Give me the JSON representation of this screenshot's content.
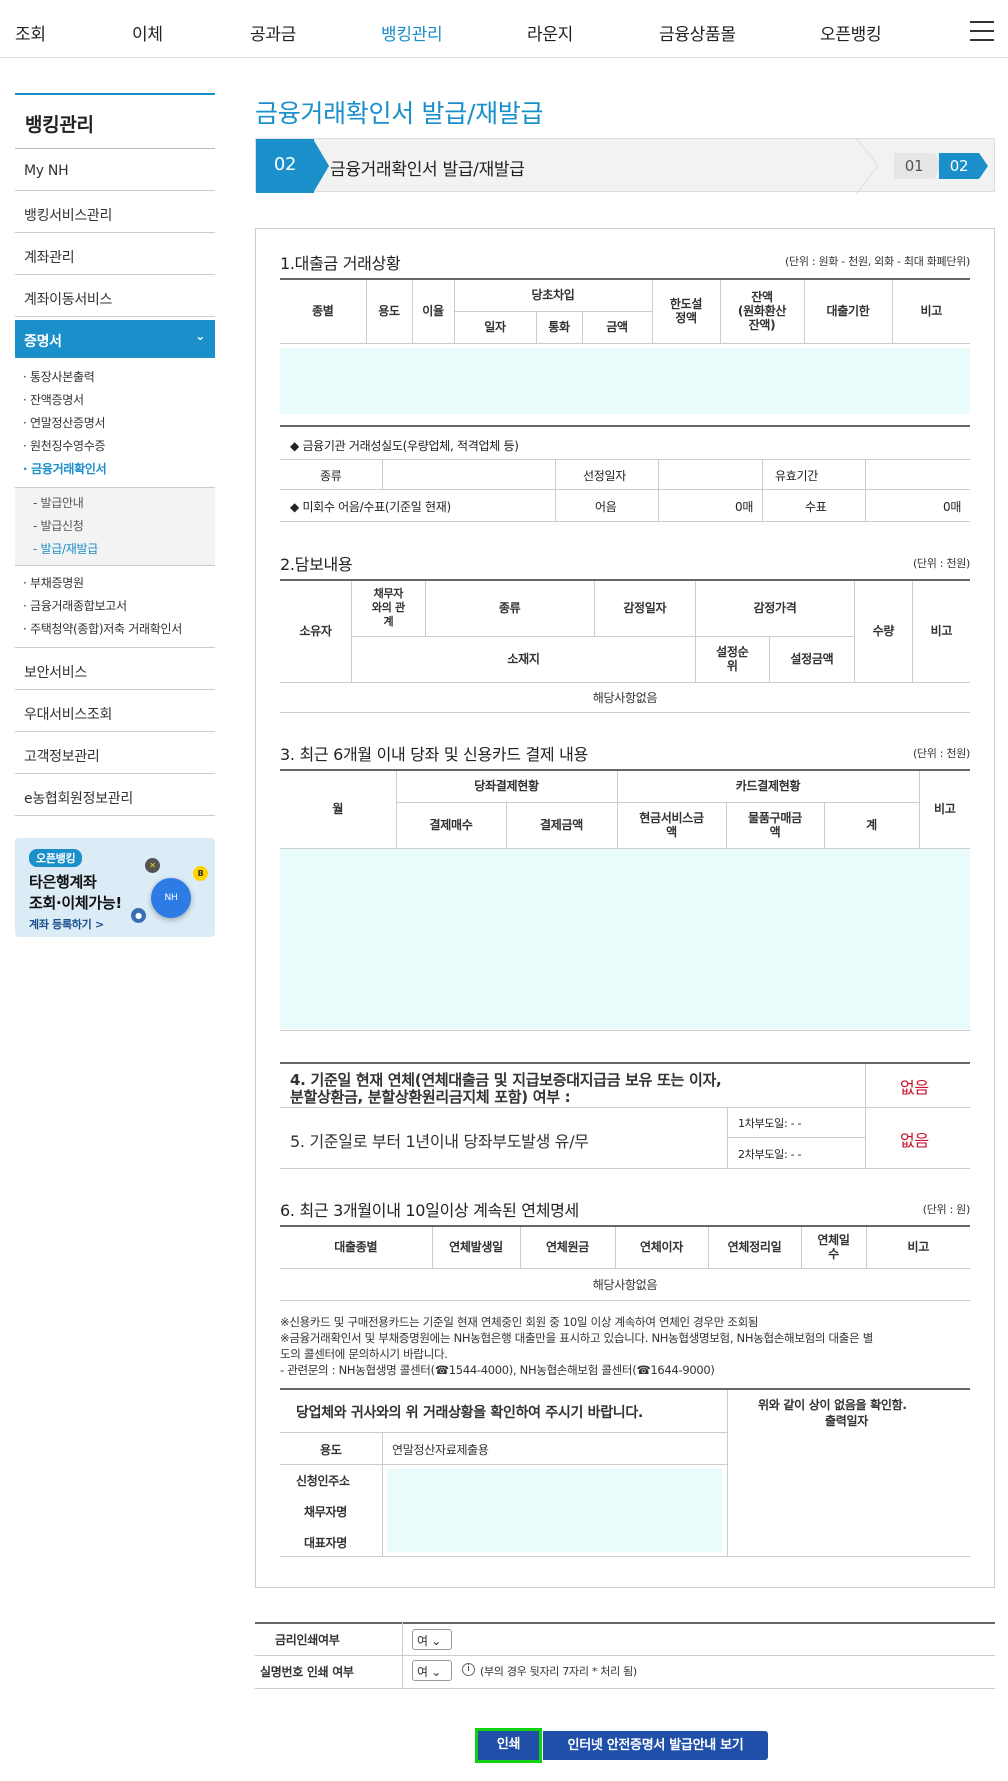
{
  "topnav": {
    "items": [
      "조회",
      "이체",
      "공과금",
      "뱅킹관리",
      "라운지",
      "금융상품몰",
      "오픈뱅킹"
    ],
    "active_index": 3
  },
  "sidebar": {
    "title": "뱅킹관리",
    "items_top": [
      "My NH",
      "뱅킹서비스관리",
      "계좌관리",
      "계좌이동서비스"
    ],
    "active": "증명서",
    "sub_items": [
      "· 통장사본출력",
      "· 잔액증명서",
      "· 연말정산증명서",
      "· 원천징수영수증",
      "· 금융거래확인서"
    ],
    "subsub_items": [
      "- 발급안내",
      "- 발급신청",
      "- 발급/재발급"
    ],
    "sub_items2": [
      "· 부채증명원",
      "· 금융거래종합보고서",
      "· 주택청약(종합)저축 거래확인서"
    ],
    "items_bottom": [
      "보안서비스",
      "우대서비스조회",
      "고객정보관리",
      "e농협회원정보관리"
    ],
    "banner": {
      "badge": "오픈뱅킹",
      "line1": "타은행계좌",
      "line2": "조회·이체가능!",
      "link": "계좌 등록하기 >",
      "circle": "NH"
    }
  },
  "main": {
    "title": "금융거래확인서 발급/재발급",
    "step": {
      "num": "02",
      "label": "금융거래확인서 발급/재발급",
      "s1": "01",
      "s2": "02"
    },
    "sec1": {
      "title": "1.대출금 거래상황",
      "unit": "(단위 : 원화 - 천원, 외화 - 최대 화폐단위)",
      "h_type": "종별",
      "h_use": "용도",
      "h_rate": "이율",
      "h_first": "당초차입",
      "h_date": "일자",
      "h_cur": "통화",
      "h_amt": "금액",
      "h_limit1": "한도설",
      "h_limit2": "정액",
      "h_bal1": "잔액",
      "h_bal2": "(원화환산",
      "h_bal3": "잔액)",
      "h_due": "대출기한",
      "h_note": "비고",
      "inst_title": "◆ 금융기관 거래성실도(우량업체, 적격업체 등)",
      "kind": "종류",
      "sel_date": "선정일자",
      "valid": "유효기간",
      "unpaid": "◆ 미회수 어음/수표(기준일 현재)",
      "bill": "어음",
      "bill_val": "0매",
      "check": "수표",
      "check_val": "0매"
    },
    "sec2": {
      "title": "2.담보내용",
      "unit": "(단위 : 천원)",
      "h_owner": "소유자",
      "h_rel1": "채무자",
      "h_rel2": "와의 관",
      "h_rel3": "계",
      "h_kind": "종류",
      "h_appdate": "감정일자",
      "h_appprice": "감정가격",
      "h_qty": "수량",
      "h_note": "비고",
      "h_loc": "소재지",
      "h_rank1": "설정순",
      "h_rank2": "위",
      "h_setamt": "설정금액",
      "none": "해당사항없음"
    },
    "sec3": {
      "title": "3. 최근 6개월 이내 당좌 및 신용카드 결제 내용",
      "unit": "(단위 : 천원)",
      "h_month": "월",
      "h_acct": "당좌결제현황",
      "h_card": "카드결제현황",
      "h_note": "비고",
      "h_cnt": "결제매수",
      "h_amt": "결제금액",
      "h_cash1": "현금서비스금",
      "h_cash2": "액",
      "h_goods1": "물품구매금",
      "h_goods2": "액",
      "h_sum": "계"
    },
    "sec4": {
      "l1": "4. 기준일 현재 연체(연체대출금 및 지급보증대지급금 보유 또는 이자,",
      "l2": "분할상환금, 분할상환원리금지체 포함) 여부 :",
      "val": "없음"
    },
    "sec5": {
      "label": "5. 기준일로 부터 1년이내 당좌부도발생 유/무",
      "d1": "1차부도일: - -",
      "d2": "2차부도일: - -",
      "val": "없음"
    },
    "sec6": {
      "title": "6. 최근 3개월이내 10일이상 계속된 연체명세",
      "unit": "(단위 : 원)",
      "h_type": "대출종별",
      "h_start": "연체발생일",
      "h_prin": "연체원금",
      "h_int": "연체이자",
      "h_clear": "연체정리일",
      "h_days1": "연체일",
      "h_days2": "수",
      "h_note": "비고",
      "none": "해당사항없음"
    },
    "notes": [
      "※신용카드 및 구매전용카드는 기준일 현재 연체중인 회원 중 10일 이상 계속하여 연체인 경우만 조회됨",
      "※금융거래확인서 및 부채증명원에는 NH농협은행 대출만을 표시하고 있습니다. NH농협생명보험, NH농협손해보험의 대출은 별",
      "도의 콜센터에 문의하시기 바랍니다.",
      "- 관련문의 : NH농협생명 콜센터(☎1544-4000), NH농협손해보험 콜센터(☎1644-9000)"
    ],
    "confirm": {
      "left": "당업체와 귀사와의 위 거래상황을 확인하여 주시기 바랍니다.",
      "right1": "위와 같이 상이 없음을 확인함.",
      "right2": "출력일자",
      "use_lbl": "용도",
      "use_val": "연말정산자료제출용",
      "addr": "신청인주소",
      "debtor": "채무자명",
      "rep": "대표자명"
    },
    "options": {
      "rate_lbl": "금리인쇄여부",
      "rate_val": "여",
      "id_lbl": "실명번호 인쇄 여부",
      "id_val": "여",
      "id_hint": "(부의 경우 뒷자리 7자리 * 처리 됨)",
      "info_icon": "i"
    },
    "buttons": {
      "print": "인쇄",
      "guide": "인터넷 안전증명서 발급안내 보기"
    }
  }
}
